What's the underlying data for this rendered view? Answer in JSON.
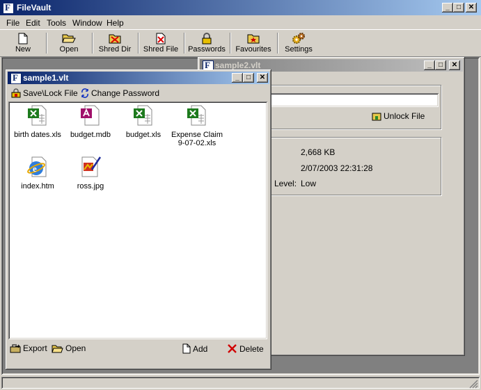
{
  "app": {
    "title": "FileVault"
  },
  "menu": {
    "items": [
      {
        "label": "File"
      },
      {
        "label": "Edit"
      },
      {
        "label": "Tools"
      },
      {
        "label": "Window"
      },
      {
        "label": "Help"
      }
    ]
  },
  "toolbar": {
    "items": [
      {
        "label": "New",
        "icon": "new-document-icon"
      },
      {
        "label": "Open",
        "icon": "open-folder-icon"
      },
      {
        "label": "Shred Dir",
        "icon": "shred-directory-icon"
      },
      {
        "label": "Shred File",
        "icon": "shred-file-icon"
      },
      {
        "label": "Passwords",
        "icon": "padlock-icon"
      },
      {
        "label": "Favourites",
        "icon": "favourites-folder-icon"
      },
      {
        "label": "Settings",
        "icon": "gears-icon"
      }
    ]
  },
  "sample2": {
    "title": "sample2.vlt",
    "unlock_label": "Unlock File",
    "size": "2,668 KB",
    "date": "2/07/2003 22:31:28",
    "level_label": "Level:",
    "level_value": "Low"
  },
  "sample1": {
    "title": "sample1.vlt",
    "save_lock_label": "Save\\Lock File",
    "change_password_label": "Change Password",
    "files": [
      {
        "name": "birth dates.xls",
        "icon": "excel-file-icon"
      },
      {
        "name": "budget.mdb",
        "icon": "access-file-icon"
      },
      {
        "name": "budget.xls",
        "icon": "excel-file-icon"
      },
      {
        "name": "Expense Claim 9-07-02.xls",
        "icon": "excel-file-icon"
      },
      {
        "name": "index.htm",
        "icon": "html-file-icon"
      },
      {
        "name": "ross.jpg",
        "icon": "image-file-icon"
      }
    ],
    "export_label": "Export",
    "open_label": "Open",
    "add_label": "Add",
    "delete_label": "Delete"
  },
  "colors": {
    "active_title": "#0a246a",
    "inactive_title": "#808080",
    "face": "#d4d0c8"
  }
}
